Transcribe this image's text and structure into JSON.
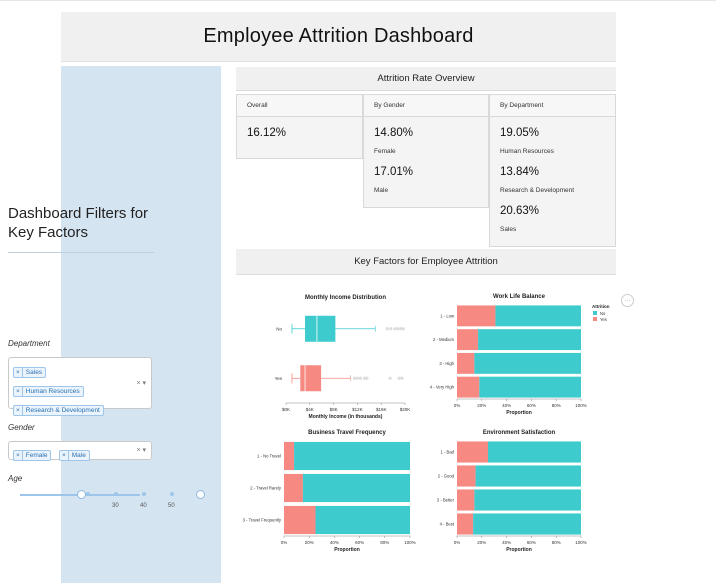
{
  "header": {
    "title": "Employee Attrition Dashboard"
  },
  "sidebar": {
    "title": "Dashboard Filters for Key Factors",
    "department_label": "Department",
    "department_selected": [
      "Sales",
      "Human Resources",
      "Research & Development"
    ],
    "gender_label": "Gender",
    "gender_selected": [
      "Female",
      "Male"
    ],
    "age_label": "Age",
    "age_ticks": [
      "30",
      "40",
      "50"
    ],
    "clear_symbol": "×",
    "caret_symbol": "▾"
  },
  "overview": {
    "title": "Attrition Rate Overview",
    "overall": {
      "header": "Overall",
      "value": "16.12%"
    },
    "gender": {
      "header": "By Gender",
      "items": [
        {
          "value": "14.80%",
          "label": "Female"
        },
        {
          "value": "17.01%",
          "label": "Male"
        }
      ]
    },
    "department": {
      "header": "By Department",
      "items": [
        {
          "value": "19.05%",
          "label": "Human Resources"
        },
        {
          "value": "13.84%",
          "label": "Research & Development"
        },
        {
          "value": "20.63%",
          "label": "Sales"
        }
      ]
    }
  },
  "factors": {
    "title": "Key Factors for Employee Attrition",
    "menu_symbol": "···"
  },
  "colors": {
    "no": "#3dcbce",
    "yes": "#f68a82",
    "accent": "#2a6fb0"
  },
  "legend": {
    "title": "Attrition",
    "items": [
      {
        "label": "No",
        "color": "#3dcbce"
      },
      {
        "label": "Yes",
        "color": "#f68a82"
      }
    ]
  },
  "chart_data": [
    {
      "type": "boxplot",
      "title": "Monthly Income Distribution",
      "xlabel": "Monthly Income (in thousands)",
      "xticks": [
        "$0K",
        "$4K",
        "$8K",
        "$12K",
        "$16K",
        "$20K"
      ],
      "xlim": [
        0,
        20
      ],
      "categories": [
        "No",
        "Yes"
      ],
      "boxes": [
        {
          "name": "No",
          "min": 1.0,
          "q1": 3.2,
          "median": 5.2,
          "q3": 8.3,
          "max": 15.0,
          "outliers": [
            17.0,
            17.6,
            18.3,
            18.8,
            19.3,
            19.7
          ]
        },
        {
          "name": "Yes",
          "min": 1.0,
          "q1": 2.4,
          "median": 3.2,
          "q3": 5.9,
          "max": 10.8,
          "outliers": [
            11.5,
            12.0,
            12.5,
            13.2,
            13.6,
            17.5,
            19.0,
            19.5
          ]
        }
      ]
    },
    {
      "type": "bar",
      "stacked": true,
      "orientation": "horizontal",
      "title": "Work Life Balance",
      "xlabel": "Proportion",
      "xticks": [
        "0%",
        "20%",
        "40%",
        "60%",
        "80%",
        "100%"
      ],
      "categories": [
        "1 - Low",
        "2 - Medium",
        "3 - High",
        "4 - Very High"
      ],
      "series": [
        {
          "name": "Yes",
          "values": [
            0.31,
            0.17,
            0.14,
            0.18
          ]
        },
        {
          "name": "No",
          "values": [
            0.69,
            0.83,
            0.86,
            0.82
          ]
        }
      ]
    },
    {
      "type": "bar",
      "stacked": true,
      "orientation": "horizontal",
      "title": "Business Travel Frequency",
      "xlabel": "Proportion",
      "xticks": [
        "0%",
        "20%",
        "40%",
        "60%",
        "80%",
        "100%"
      ],
      "categories": [
        "1 - No Travel",
        "2 - Travel Rarely",
        "3 - Travel Frequently"
      ],
      "series": [
        {
          "name": "Yes",
          "values": [
            0.08,
            0.15,
            0.25
          ]
        },
        {
          "name": "No",
          "values": [
            0.92,
            0.85,
            0.75
          ]
        }
      ]
    },
    {
      "type": "bar",
      "stacked": true,
      "orientation": "horizontal",
      "title": "Environment Satisfaction",
      "xlabel": "Proportion",
      "xticks": [
        "0%",
        "20%",
        "40%",
        "60%",
        "80%",
        "100%"
      ],
      "categories": [
        "1 - Bad",
        "2 - Good",
        "3 - Better",
        "4 - Best"
      ],
      "series": [
        {
          "name": "Yes",
          "values": [
            0.25,
            0.15,
            0.14,
            0.13
          ]
        },
        {
          "name": "No",
          "values": [
            0.75,
            0.85,
            0.86,
            0.87
          ]
        }
      ]
    }
  ]
}
